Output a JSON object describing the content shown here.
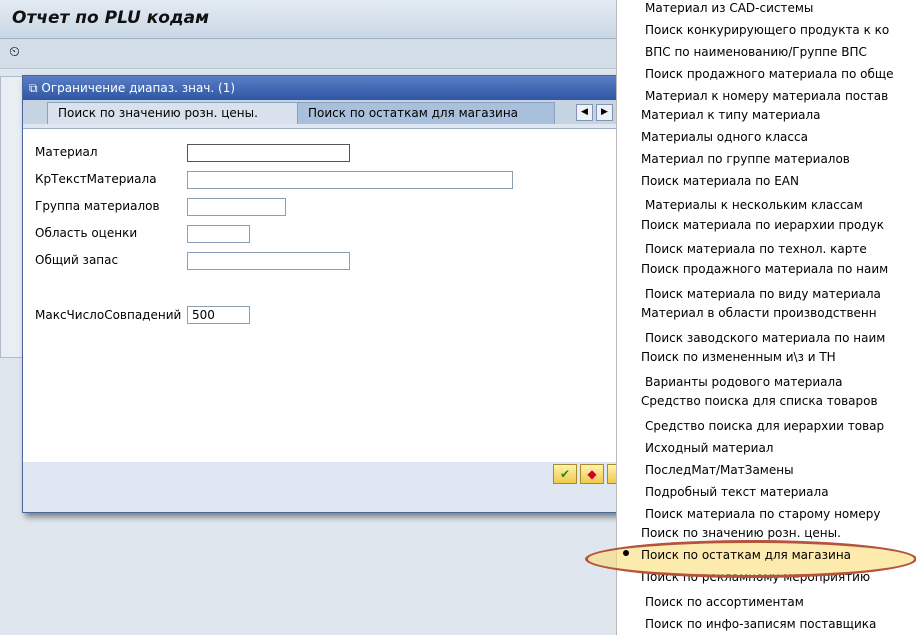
{
  "header": {
    "title": "Отчет по PLU кодам"
  },
  "toolbar": {
    "execute_icon": "clock-execute-icon"
  },
  "dialog": {
    "title": "Ограничение диапаз. знач. (1)",
    "tabs": [
      {
        "label": "Поиск  по значению розн. цены."
      },
      {
        "label": "Поиск по остаткам для магазина",
        "active": true
      }
    ],
    "fields": [
      {
        "label": "Материал",
        "value": ""
      },
      {
        "label": "КрТекстМатериала",
        "value": ""
      },
      {
        "label": "Группа материалов",
        "value": ""
      },
      {
        "label": "Область оценки",
        "value": ""
      },
      {
        "label": "Общий запас",
        "value": ""
      },
      {
        "label": "МаксЧислоСовпадений",
        "value": "500"
      }
    ],
    "buttons": [
      "ok-check-icon",
      "new-search-icon",
      "more-icon"
    ]
  },
  "menu": {
    "items": [
      "Материал из CAD-системы",
      "Поиск конкурирующего продукта к ко",
      "ВПС по наименованию/Группе ВПС",
      "Поиск продажного материала по обще",
      "Материал к номеру материала постав",
      "Материал к типу материала",
      "Материалы одного класса",
      "Материал по группе материалов",
      "Поиск материала по EAN",
      "Материалы к нескольким классам",
      "Поиск материала по иерархии продук",
      "Поиск материала по технол. карте",
      "Поиск продажного материала по наим",
      "Поиск материала по виду материала",
      "Материал в области производственн",
      "Поиск заводского материала по наим",
      "Поиск по измененным и\\з и ТН",
      "Варианты родового материала",
      "Средство поиска для списка товаров",
      "Средство поиска для иерархии товар",
      "Исходный материал",
      "ПоследМат/МатЗамены",
      "Подробный текст материала",
      "Поиск материала по старому номеру",
      "Поиск  по значению розн. цены.",
      "Поиск по остаткам для магазина",
      "Поиск по рекламному мероприятию",
      "Поиск по ассортиментам",
      "Поиск по инфо-записям поставщика"
    ],
    "selected": "Поиск по остаткам для магазина",
    "highlight_color": "#b5533c"
  }
}
